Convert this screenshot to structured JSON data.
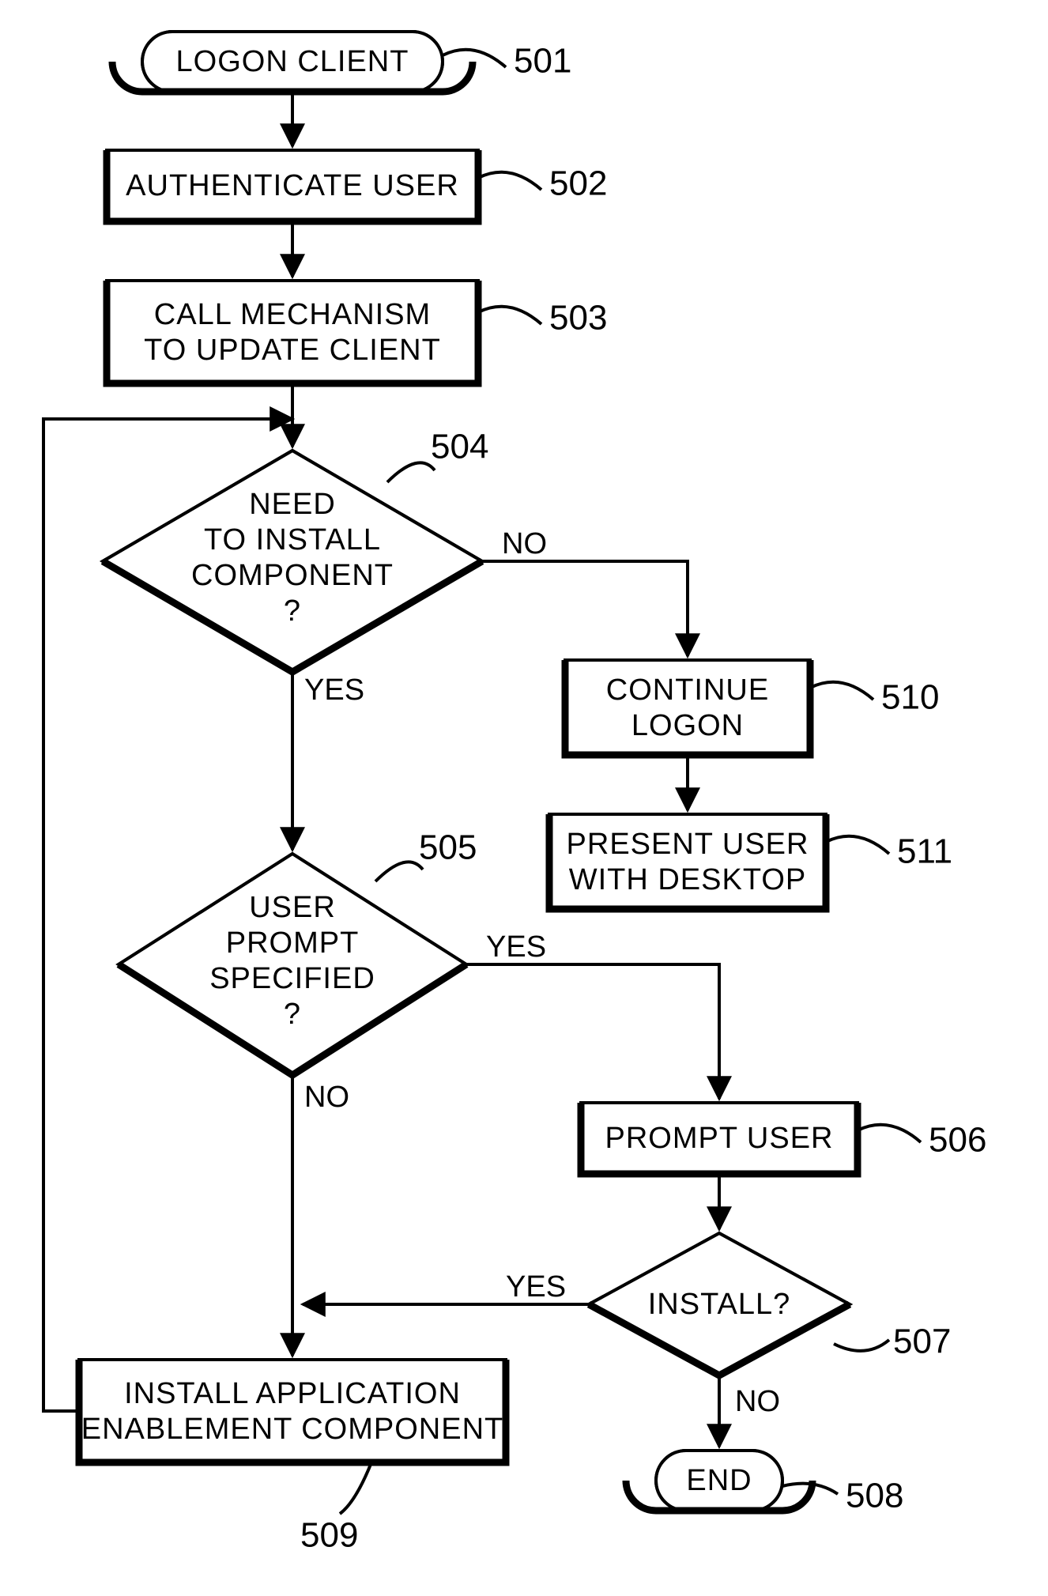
{
  "nodes": {
    "n501": {
      "text": "LOGON CLIENT",
      "ref": "501"
    },
    "n502": {
      "text": "AUTHENTICATE USER",
      "ref": "502"
    },
    "n503": {
      "line1": "CALL MECHANISM",
      "line2": "TO UPDATE CLIENT",
      "ref": "503"
    },
    "n504": {
      "line1": "NEED",
      "line2": "TO INSTALL",
      "line3": "COMPONENT",
      "line4": "?",
      "ref": "504"
    },
    "n505": {
      "line1": "USER",
      "line2": "PROMPT",
      "line3": "SPECIFIED",
      "line4": "?",
      "ref": "505"
    },
    "n506": {
      "text": "PROMPT USER",
      "ref": "506"
    },
    "n507": {
      "text": "INSTALL?",
      "ref": "507"
    },
    "n508": {
      "text": "END",
      "ref": "508"
    },
    "n509": {
      "line1": "INSTALL APPLICATION",
      "line2": "ENABLEMENT COMPONENT",
      "ref": "509"
    },
    "n510": {
      "line1": "CONTINUE",
      "line2": "LOGON",
      "ref": "510"
    },
    "n511": {
      "line1": "PRESENT USER",
      "line2": "WITH DESKTOP",
      "ref": "511"
    }
  },
  "edges": {
    "e504no": "NO",
    "e504yes": "YES",
    "e505yes": "YES",
    "e505no": "NO",
    "e507yes": "YES",
    "e507no": "NO"
  }
}
